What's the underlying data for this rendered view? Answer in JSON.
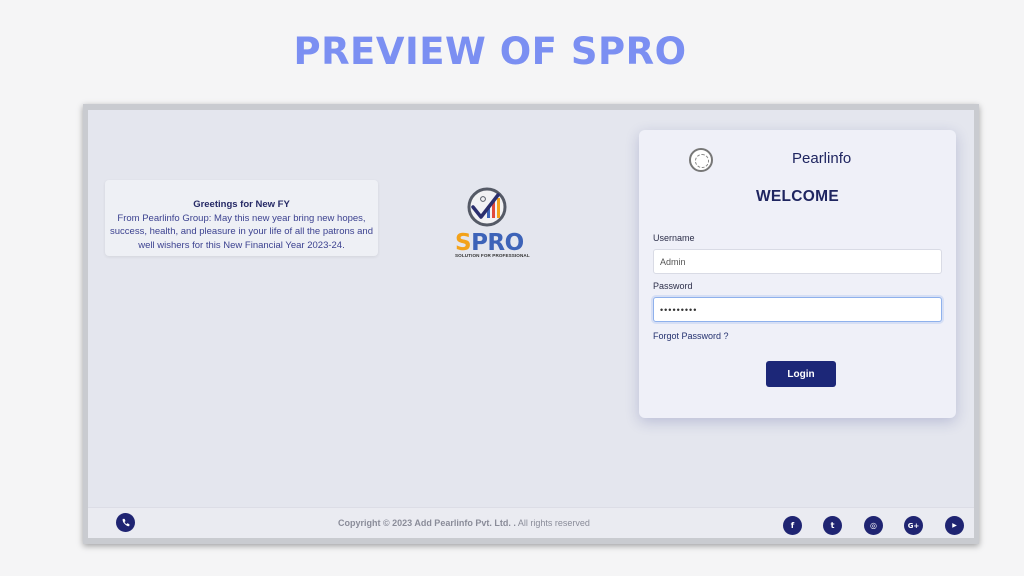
{
  "slide": {
    "title": "PREVIEW OF SPRO"
  },
  "greeting": {
    "title": "Greetings for New FY",
    "body": "From Pearlinfo Group: May this new year bring new hopes, success, health, and pleasure in your life of all the patrons and well wishers for this New Financial Year 2023-24."
  },
  "logo": {
    "name_s": "S",
    "name_rest": "PRO",
    "tagline": "SOLUTION FOR PROFESSIONAL",
    "icon": "checkmark-chart-icon"
  },
  "login": {
    "brand": "Pearlinfo",
    "brand_icon": "pearl-logo-icon",
    "welcome": "WELCOME",
    "username_label": "Username",
    "username_value": "Admin",
    "password_label": "Password",
    "password_value": "•••••••••",
    "forgot_label": "Forgot Password ?",
    "login_label": "Login"
  },
  "footer": {
    "copyright_bold": "Copyright © 2023 Add Pearlinfo Pvt. Ltd. .",
    "copyright_rest": " All rights reserved",
    "phone_icon": "phone-icon",
    "social": [
      {
        "name": "facebook-icon",
        "glyph": "f"
      },
      {
        "name": "twitter-icon",
        "glyph": "t"
      },
      {
        "name": "instagram-icon",
        "glyph": "◎"
      },
      {
        "name": "google-plus-icon",
        "glyph": "G+"
      },
      {
        "name": "youtube-icon",
        "glyph": "▶"
      }
    ]
  },
  "colors": {
    "title": "#7b8ff2",
    "primary": "#1c2778",
    "spro_orange": "#f3a21a",
    "spro_blue": "#3d63b8"
  }
}
